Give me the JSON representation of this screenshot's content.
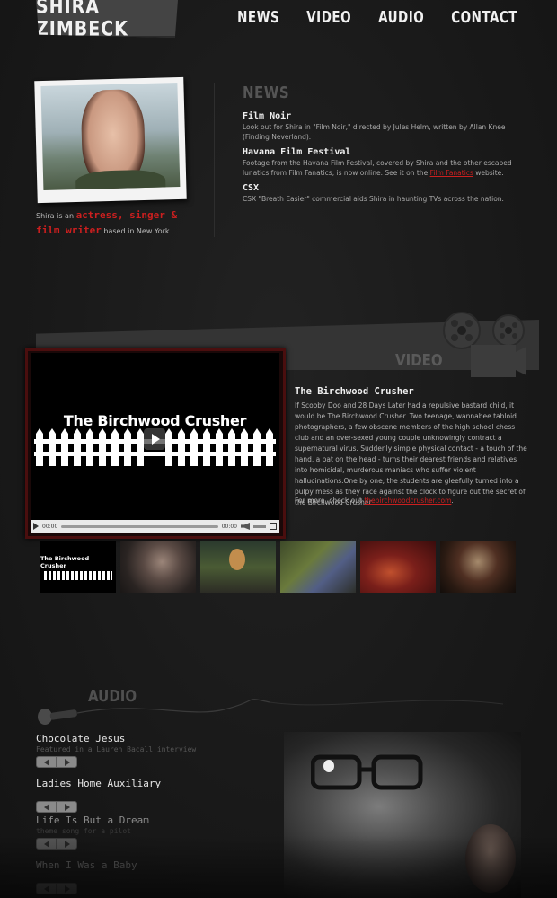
{
  "header": {
    "logo_text": "SHIRA ZIMBECK",
    "nav": [
      {
        "label": "NEWS"
      },
      {
        "label": "VIDEO"
      },
      {
        "label": "AUDIO"
      },
      {
        "label": "CONTACT"
      }
    ]
  },
  "profile": {
    "bio_prefix": "Shira is an",
    "bio_highlight_1": "actress, singer &",
    "bio_highlight_2": "film writer",
    "bio_suffix": "based in New York."
  },
  "news": {
    "heading": "NEWS",
    "items": [
      {
        "title": "Film Noir",
        "text": "Look out for Shira in \"Film Noir,\" directed by Jules Helm, written by Allan Knee (Finding Neverland)."
      },
      {
        "title": "Havana Film Festival",
        "text_before": "Footage from the Havana Film Festival, covered by Shira and the other escaped lunatics from Film Fanatics, is now online. See it on the",
        "link": "Film Fanatics",
        "text_after": "website."
      },
      {
        "title": "CSX",
        "text": "CSX \"Breath Easier\" commercial aids Shira in haunting TVs across the nation."
      }
    ]
  },
  "video": {
    "section_label": "VIDEO",
    "player": {
      "title": "The Birchwood Crusher",
      "time_current": "00:00",
      "time_total": "00:00"
    },
    "title": "The Birchwood Crusher",
    "description": "If Scooby Doo and 28 Days Later had a repulsive bastard child, it would be The Birchwood Crusher. Two teenage, wannabee tabloid photographers, a few obscene members of the high school chess club and an over-sexed young couple unknowingly contract a supernatural virus. Suddenly simple physical contact - a touch of the hand, a pat on the head - turns their dearest friends and relatives into homicidal, murderous maniacs who suffer violent hallucinations.One by one, the students are gleefully turned into a pulpy mess as they race against the clock to figure out the secret of the Birchwood Crusher.",
    "more_prefix": "For more, check out",
    "more_link": "thebirchwoodcrusher.com",
    "more_suffix": ".",
    "thumb1_text": "The Birchwood Crusher"
  },
  "audio": {
    "section_label": "AUDIO",
    "tracks": [
      {
        "title": "Chocolate Jesus",
        "subtitle": "Featured in a Lauren Bacall interview"
      },
      {
        "title": "Ladies Home Auxiliary",
        "subtitle": ""
      },
      {
        "title": "Life Is But a Dream",
        "subtitle": "theme song for a pilot"
      },
      {
        "title": "When I Was a Baby",
        "subtitle": ""
      }
    ]
  },
  "colors": {
    "background": "#1c1c1c",
    "accent_red": "#cc1f1f",
    "player_border": "#4a0e0e"
  }
}
